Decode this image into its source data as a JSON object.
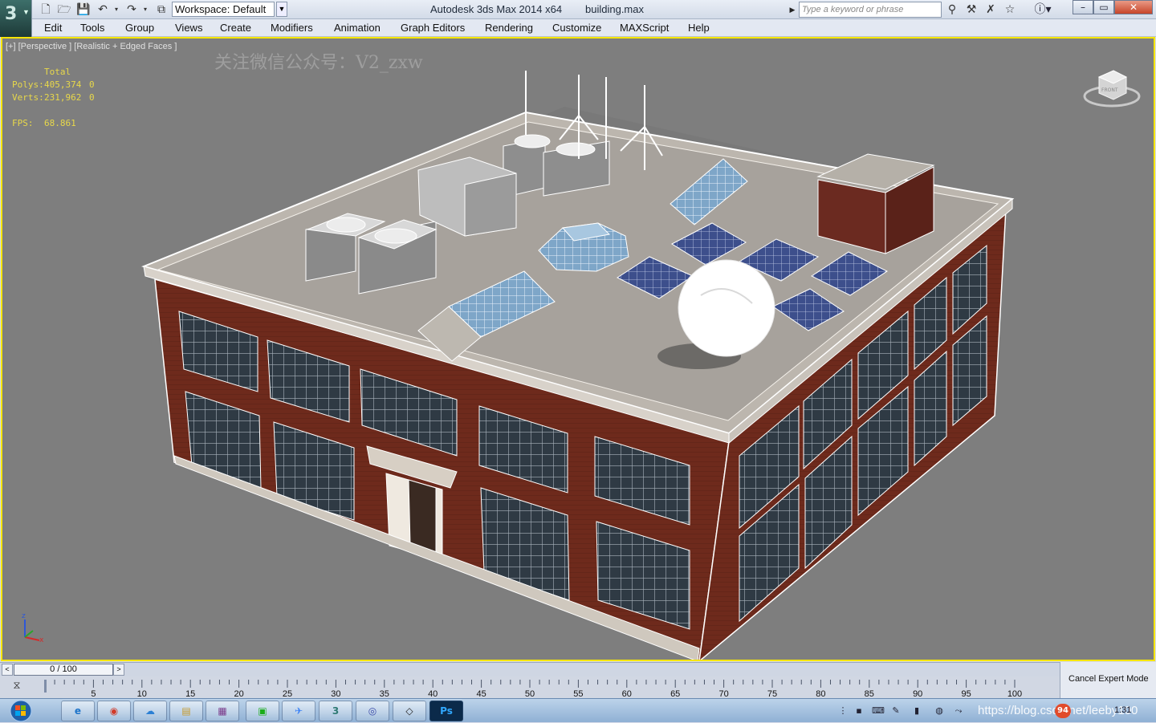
{
  "app": {
    "title": "Autodesk 3ds Max  2014 x64",
    "file": "building.max",
    "workspace": "Workspace: Default",
    "search_placeholder": "Type a keyword or phrase",
    "help": "?",
    "window_controls": {
      "minimize": "–",
      "maximize": "▭",
      "close": "✕"
    }
  },
  "quick_access": [
    "new-file",
    "open-file",
    "save-file",
    "undo",
    "redo",
    "project-folder"
  ],
  "menu": [
    "Edit",
    "Tools",
    "Group",
    "Views",
    "Create",
    "Modifiers",
    "Animation",
    "Graph Editors",
    "Rendering",
    "Customize",
    "MAXScript",
    "Help"
  ],
  "viewport": {
    "label": "[+] [Perspective ] [Realistic + Edged Faces ]",
    "watermark": "关注微信公众号：V2_zxw",
    "stats": {
      "header": "Total",
      "polys_label": "Polys:",
      "polys_value": "405,374",
      "polys_sel": "0",
      "verts_label": "Verts:",
      "verts_value": "231,962",
      "verts_sel": "0",
      "fps_label": "FPS:",
      "fps_value": "68.861"
    },
    "viewcube_face": "FRONT",
    "axis": {
      "z": "z",
      "x": "x"
    }
  },
  "timeline": {
    "slider": "0 / 100",
    "prev": "<",
    "next": ">",
    "ticks": [
      "5",
      "10",
      "15",
      "20",
      "25",
      "30",
      "35",
      "40",
      "45",
      "50",
      "55",
      "60",
      "65",
      "70",
      "75",
      "80",
      "85",
      "90",
      "95",
      "100"
    ]
  },
  "status": {
    "cancel_expert": "Cancel Expert Mode"
  },
  "taskbar": {
    "apps": [
      "internet-explorer",
      "chrome",
      "baidu-netdisk",
      "file-explorer",
      "winrar",
      "wechat",
      "feishu",
      "3ds-max",
      "screen-recorder",
      "unity",
      "photoshop"
    ],
    "photoshop_label": "Ps",
    "tray_url": "https://blog.csdn.net/leeby100",
    "badge": "94",
    "clock": "1:31"
  },
  "colors": {
    "viewport_bg": "#7e7e7e",
    "viewport_border": "#f6e600",
    "stats_text": "#e8d84a",
    "brick": "#6e2a1c",
    "roof": "#a7a29c"
  }
}
